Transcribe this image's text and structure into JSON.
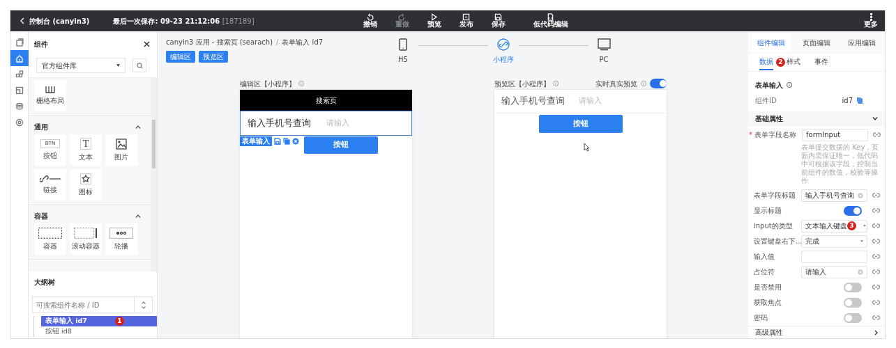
{
  "topbar": {
    "back_label": "控制台 (canyin3)",
    "save_label": "最后一次保存: 09-23 21:12:06",
    "save_id": "[187189]",
    "actions": [
      {
        "label": "撤销",
        "disabled": false
      },
      {
        "label": "重做",
        "disabled": true
      },
      {
        "label": "预览",
        "disabled": false
      },
      {
        "label": "发布",
        "disabled": false
      },
      {
        "label": "保存",
        "disabled": false
      },
      {
        "label": "低代码编辑",
        "disabled": false
      }
    ],
    "more_label": "更多"
  },
  "rail": [
    {
      "selected": false
    },
    {
      "selected": true
    },
    {
      "selected": false
    },
    {
      "selected": false
    },
    {
      "selected": false
    },
    {
      "selected": false
    }
  ],
  "component_panel": {
    "title": "组件",
    "library": "官方组件库",
    "groups": [
      {
        "items": [
          {
            "label": "栅格布局"
          }
        ]
      },
      {
        "title": "通用",
        "expanded": true,
        "items": [
          {
            "label": "按钮",
            "icon_text": "BTN"
          },
          {
            "label": "文本",
            "icon_text": "T"
          },
          {
            "label": "图片"
          },
          {
            "label": "链接"
          },
          {
            "label": "图标"
          }
        ]
      },
      {
        "title": "容器",
        "expanded": true,
        "items": [
          {
            "label": "容器"
          },
          {
            "label": "滚动容器"
          },
          {
            "label": "轮播"
          }
        ]
      }
    ]
  },
  "outline": {
    "title": "大纲树",
    "search_placeholder": "可搜索组件名称 / ID",
    "items": [
      {
        "label": "表单输入 id7",
        "selected": true,
        "badge": "1"
      },
      {
        "label": "按钮 id8",
        "selected": false
      }
    ]
  },
  "canvas": {
    "breadcrumb": [
      "canyin3 应用 - 搜索页 (searach)",
      "表单输入 id7"
    ],
    "breadcrumb_separator": "/",
    "mode_buttons": [
      "编辑区",
      "预览区"
    ],
    "devices": [
      {
        "label": "H5",
        "selected": false
      },
      {
        "label": "小程序",
        "selected": true
      },
      {
        "label": "PC",
        "selected": false
      }
    ],
    "editor": {
      "title": "编辑区【小程序】",
      "page_title": "搜索页",
      "field_label": "输入手机号查询",
      "field_placeholder": "请输入",
      "selection_tag": "表单输入",
      "button_label": "按钮"
    },
    "preview": {
      "title": "预览区【小程序】",
      "live_label": "实时真实预览",
      "live_on": true,
      "field_label": "输入手机号查询",
      "field_placeholder": "请输入",
      "button_label": "按钮"
    }
  },
  "inspector": {
    "tabs": [
      {
        "label": "组件编辑",
        "selected": true
      },
      {
        "label": "页面编辑",
        "selected": false
      },
      {
        "label": "应用编辑",
        "selected": false
      }
    ],
    "subtabs": [
      {
        "label": "数据",
        "selected": true,
        "badge": "2"
      },
      {
        "label": "样式",
        "selected": false
      },
      {
        "label": "事件",
        "selected": false
      }
    ],
    "component_title": "表单输入",
    "id_label": "组件ID",
    "id_value": "id7",
    "section": {
      "title": "基础属性",
      "expanded": true
    },
    "props": [
      {
        "kind": "input",
        "label": "表单字段名称",
        "required_mark": "*",
        "value": "formInput",
        "hint": "表单提交数据的 Key，页面内需保证唯一，低代码中可根据该字段，控制当前组件的数值，校验等操作"
      },
      {
        "kind": "input",
        "label": "表单字段标题",
        "value": "输入手机号查询",
        "clearable": true
      },
      {
        "kind": "switch",
        "label": "显示标题",
        "on": true
      },
      {
        "kind": "select",
        "label": "input的类型",
        "value": "文本输入键盘",
        "badge": "3"
      },
      {
        "kind": "select",
        "label": "设置键盘右下...",
        "value": "完成"
      },
      {
        "kind": "input",
        "label": "输入值"
      },
      {
        "kind": "input",
        "label": "占位符",
        "value": "请输入",
        "clearable": true
      },
      {
        "kind": "switch",
        "label": "是否禁用",
        "on": false
      },
      {
        "kind": "switch",
        "label": "获取焦点",
        "on": false
      },
      {
        "kind": "switch",
        "label": "密码",
        "on": false
      }
    ],
    "advanced": {
      "title": "高级属性",
      "expanded": false
    }
  }
}
